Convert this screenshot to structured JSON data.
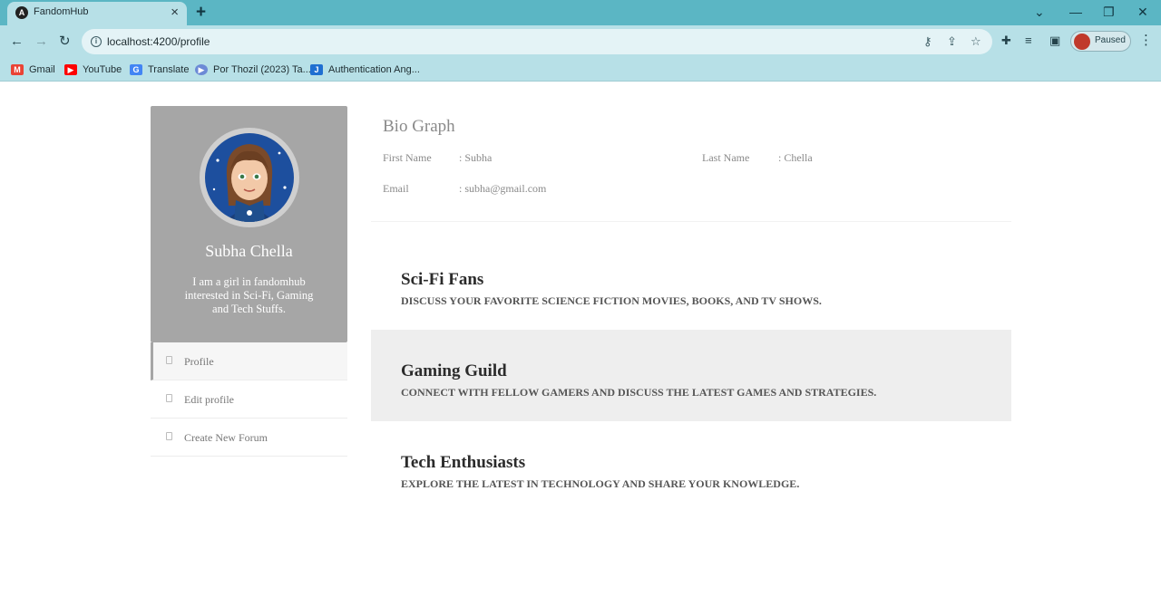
{
  "browser": {
    "tab_title": "FandomHub",
    "tab_favicon": "A",
    "url": "localhost:4200/profile",
    "profile_status": "Paused",
    "bookmarks": [
      {
        "label": "Gmail",
        "icon": "M",
        "color": "#ea4335"
      },
      {
        "label": "YouTube",
        "icon": "▶",
        "color": "#ff0000"
      },
      {
        "label": "Translate",
        "icon": "G",
        "color": "#4285f4"
      },
      {
        "label": "Por Thozil (2023) Ta...",
        "icon": "▶",
        "color": "#6c8ad6"
      },
      {
        "label": "Authentication Ang...",
        "icon": "J",
        "color": "#1f6fd1"
      }
    ]
  },
  "profile": {
    "name": "Subha Chella",
    "bio": "I am a girl in fandomhub interested in Sci-Fi, Gaming and Tech Stuffs."
  },
  "menu": [
    {
      "label": "Profile",
      "active": true
    },
    {
      "label": "Edit profile",
      "active": false
    },
    {
      "label": "Create New Forum",
      "active": false
    }
  ],
  "bio_graph": {
    "title": "Bio Graph",
    "first_name_label": "First Name",
    "first_name_value": ": Subha",
    "last_name_label": "Last Name",
    "last_name_value": ": Chella",
    "email_label": "Email",
    "email_value": ": subha@gmail.com"
  },
  "forums": [
    {
      "title": "Sci-Fi Fans",
      "description": "Discuss your favorite science fiction movies, books, and TV shows."
    },
    {
      "title": "Gaming Guild",
      "description": "Connect with fellow gamers and discuss the latest games and strategies."
    },
    {
      "title": "Tech Enthusiasts",
      "description": "Explore the latest in technology and share your knowledge."
    }
  ],
  "colors": {
    "chrome_title": "#5bb6c4",
    "chrome_toolbar": "#b7e0e7",
    "card_bg": "#a6a6a6",
    "alt_row": "#eeeeee"
  }
}
